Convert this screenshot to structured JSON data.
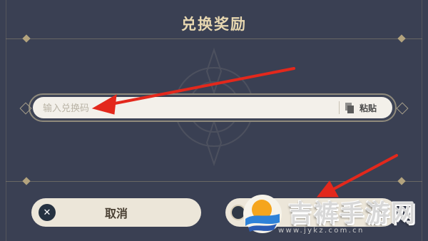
{
  "dialog": {
    "title": "兑换奖励"
  },
  "code_input": {
    "placeholder": "输入兑换码",
    "value": ""
  },
  "paste": {
    "icon": "paste-icon",
    "label": "粘贴"
  },
  "actions": {
    "cancel_label": "取消",
    "cancel_icon": "close-icon",
    "confirm_label": "",
    "confirm_icon": "confirm-icon"
  },
  "watermark": {
    "title": "吉裤手游网",
    "url": "www.jykz.com.cn"
  },
  "colors": {
    "background": "#3a4053",
    "title": "#e7d7b0",
    "arrow": "#e3281c",
    "button_bg": "#ece6d9"
  }
}
